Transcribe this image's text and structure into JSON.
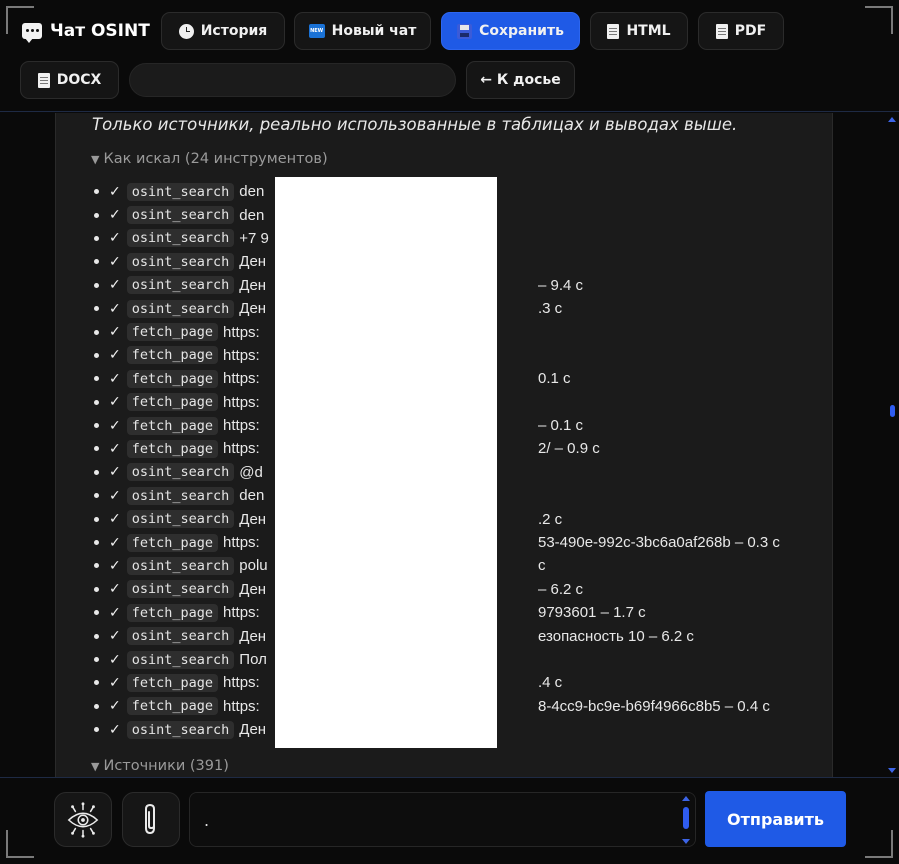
{
  "header": {
    "title": "Чат OSINT",
    "buttons": {
      "history": "История",
      "new_chat": "Новый чат",
      "save": "Сохранить",
      "html": "HTML",
      "pdf": "PDF",
      "docx": "DOCX",
      "back": "← К досье"
    }
  },
  "content": {
    "note": "Только источники, реально использованные в таблицах и выводах выше.",
    "tools_summary": "Как искал (24 инструментов)",
    "sources_summary": "Источники (391)",
    "tools": [
      {
        "name": "osint_search",
        "desc": "den"
      },
      {
        "name": "osint_search",
        "desc": "den"
      },
      {
        "name": "osint_search",
        "desc": "+7 9"
      },
      {
        "name": "osint_search",
        "desc": "Ден"
      },
      {
        "name": "osint_search",
        "desc": "Ден",
        "tail": "– 9.4 с"
      },
      {
        "name": "osint_search",
        "desc": "Ден",
        "tail": ".3 с"
      },
      {
        "name": "fetch_page",
        "desc": "https:"
      },
      {
        "name": "fetch_page",
        "desc": "https:"
      },
      {
        "name": "fetch_page",
        "desc": "https:",
        "tail": "0.1 с"
      },
      {
        "name": "fetch_page",
        "desc": "https:"
      },
      {
        "name": "fetch_page",
        "desc": "https:",
        "tail": "– 0.1 с"
      },
      {
        "name": "fetch_page",
        "desc": "https:",
        "tail": "2/ – 0.9 с"
      },
      {
        "name": "osint_search",
        "desc": "@d"
      },
      {
        "name": "osint_search",
        "desc": "den"
      },
      {
        "name": "osint_search",
        "desc": "Ден",
        "tail": ".2 с"
      },
      {
        "name": "fetch_page",
        "desc": "https:",
        "tail": "53-490e-992c-3bc6a0af268b – 0.3 с"
      },
      {
        "name": "osint_search",
        "desc": "polu",
        "tail": "с"
      },
      {
        "name": "osint_search",
        "desc": "Ден",
        "tail": "– 6.2 с"
      },
      {
        "name": "fetch_page",
        "desc": "https:",
        "tail": "9793601 – 1.7 с"
      },
      {
        "name": "osint_search",
        "desc": "Ден",
        "tail": "езопасность 10 – 6.2 с"
      },
      {
        "name": "osint_search",
        "desc": "Пол"
      },
      {
        "name": "fetch_page",
        "desc": "https:",
        "tail": ".4 с"
      },
      {
        "name": "fetch_page",
        "desc": "https:",
        "tail": "8-4cc9-bc9e-b69f4966c8b5 – 0.4 с"
      },
      {
        "name": "osint_search",
        "desc": "Ден"
      }
    ]
  },
  "composer": {
    "input_value": ".",
    "send": "Отправить"
  },
  "colors": {
    "accent": "#1f5ae6",
    "background": "#0a0a0a",
    "panel": "#1b1b1b"
  }
}
